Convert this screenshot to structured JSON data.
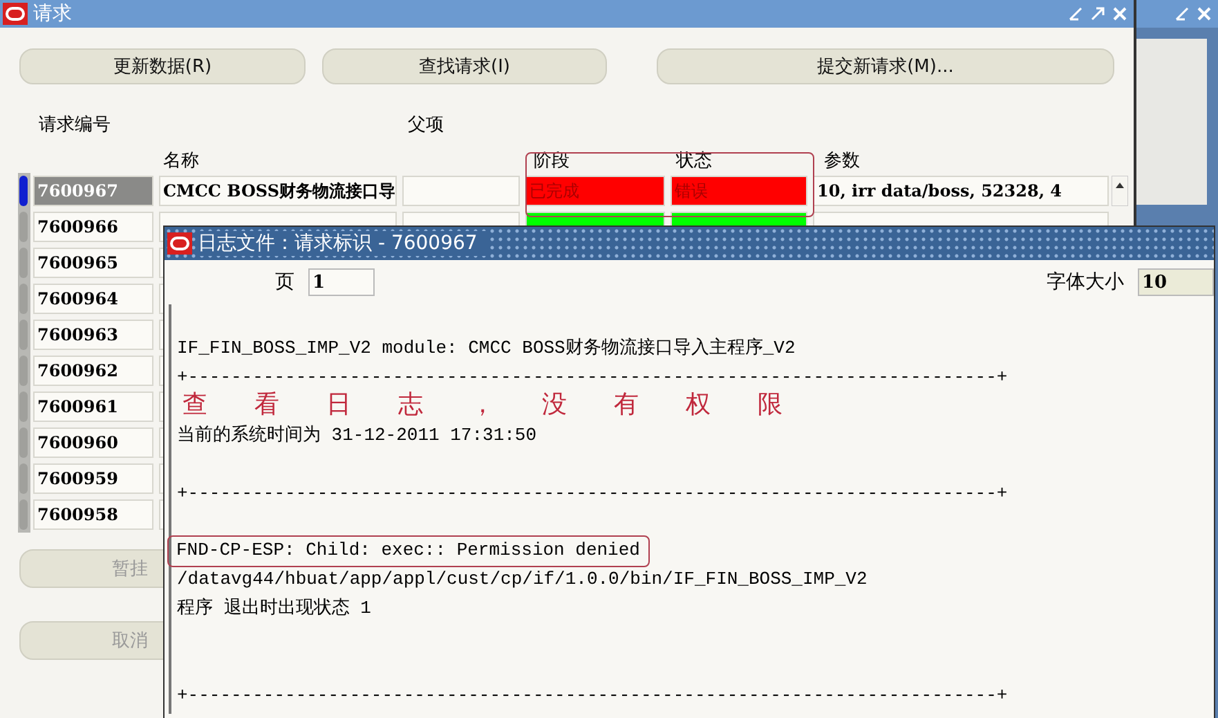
{
  "window": {
    "title": "请求"
  },
  "buttons": [
    {
      "label": "更新数据(R)"
    },
    {
      "label": "查找请求(I)"
    },
    {
      "label": "提交新请求(M)..."
    }
  ],
  "columns": {
    "id": "请求编号",
    "parent": "父项",
    "name": "名称",
    "phase": "阶段",
    "status": "状态",
    "params": "参数"
  },
  "rows": [
    {
      "id": "7600967",
      "name": "CMCC BOSS财务物流接口导",
      "phase": "已完成",
      "status": "错误",
      "params": "10, irr data/boss, 52328, 4",
      "color": "#ff0000",
      "selected": true
    },
    {
      "id": "7600966",
      "color": "#00ff00",
      "selected": false
    },
    {
      "id": "7600965",
      "selected": false
    },
    {
      "id": "7600964",
      "selected": false
    },
    {
      "id": "7600963",
      "selected": false
    },
    {
      "id": "7600962",
      "selected": false
    },
    {
      "id": "7600961",
      "selected": false
    },
    {
      "id": "7600960",
      "selected": false
    },
    {
      "id": "7600959",
      "selected": false
    },
    {
      "id": "7600958",
      "selected": false
    }
  ],
  "lower_buttons": [
    {
      "label": "暂挂",
      "disabled": true
    },
    {
      "label": "取消",
      "disabled": true
    }
  ],
  "log_window": {
    "title": "日志文件：请求标识 - 7600967",
    "page_label": "页",
    "page": "1",
    "font_size_label": "字体大小",
    "font_size": "10",
    "lines": [
      {
        "kind": "blank"
      },
      {
        "kind": "text",
        "text": "IF_FIN_BOSS_IMP_V2 module: CMCC BOSS财务物流接口导入主程序_V2"
      },
      {
        "kind": "text",
        "text": "+---------------------------------------------------------------------------+"
      },
      {
        "kind": "blank"
      },
      {
        "kind": "text",
        "text": "当前的系统时间为 31-12-2011 17:31:50"
      },
      {
        "kind": "blank"
      },
      {
        "kind": "text",
        "text": "+---------------------------------------------------------------------------+"
      },
      {
        "kind": "blank"
      },
      {
        "kind": "text",
        "text": "FND-CP-ESP: Child: exec:: Permission denied",
        "outlined": true
      },
      {
        "kind": "text",
        "text": "/datavg44/hbuat/app/appl/cust/cp/if/1.0.0/bin/IF_FIN_BOSS_IMP_V2"
      },
      {
        "kind": "text",
        "text": "程序 退出时出现状态 1"
      },
      {
        "kind": "blank"
      },
      {
        "kind": "blank"
      },
      {
        "kind": "text",
        "text": "+---------------------------------------------------------------------------+"
      }
    ]
  },
  "annotation": {
    "text": "查看日志，没有权限"
  }
}
